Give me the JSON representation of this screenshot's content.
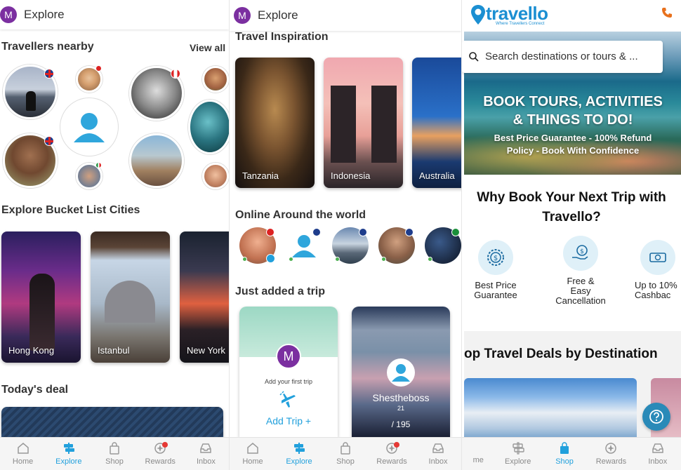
{
  "panel1": {
    "header": {
      "avatar_letter": "M",
      "title": "Explore"
    },
    "travellers": {
      "heading": "Travellers nearby",
      "view_all": "View all"
    },
    "bucket": {
      "heading": "Explore Bucket List Cities",
      "cities": [
        "Hong Kong",
        "Istanbul",
        "New York"
      ]
    },
    "deal": {
      "heading": "Today's deal"
    }
  },
  "panel2": {
    "header": {
      "avatar_letter": "M",
      "title": "Explore"
    },
    "inspiration": {
      "heading": "Travel Inspiration",
      "places": [
        "Tanzania",
        "Indonesia",
        "Australia"
      ]
    },
    "online": {
      "heading": "Online Around the world"
    },
    "added": {
      "heading": "Just added a trip",
      "card1": {
        "avatar_letter": "M",
        "subtitle": "Add your first trip",
        "action": "Add Trip +"
      },
      "card2": {
        "name": "Shestheboss",
        "count_top": "21",
        "count_bottom": "/ 195"
      }
    }
  },
  "panel3": {
    "logo": {
      "name": "travello",
      "tagline": "Where Travellers Connect"
    },
    "search": {
      "placeholder": "Search destinations or tours & ..."
    },
    "hero": {
      "line1": "BOOK TOURS, ACTIVITIES",
      "line2": "& THINGS TO DO!",
      "line3": "Best Price Guarantee - 100% Refund",
      "line4": "Policy - Book With Confidence"
    },
    "why": {
      "line1": "Why Book Your Next Trip with",
      "line2": "Travello?"
    },
    "features": [
      {
        "line1": "Best Price",
        "line2": "Guarantee",
        "line3": ""
      },
      {
        "line1": "Free &",
        "line2": "Easy",
        "line3": "Cancellation"
      },
      {
        "line1": "Up to 10%",
        "line2": "Cashbac",
        "line3": ""
      }
    ],
    "deals_heading": "op Travel Deals by Destination"
  },
  "nav": {
    "p1": [
      "Home",
      "Explore",
      "Shop",
      "Rewards",
      "Inbox"
    ],
    "p2": [
      "Home",
      "Explore",
      "Shop",
      "Rewards",
      "Inbox"
    ],
    "p3": [
      "me",
      "Explore",
      "Shop",
      "Rewards",
      "Inbox"
    ]
  },
  "colors": {
    "accent": "#21a0dc",
    "avatar": "#7b2fa0",
    "badge": "#e53935",
    "online": "#4caf50",
    "phone": "#e8711d"
  }
}
